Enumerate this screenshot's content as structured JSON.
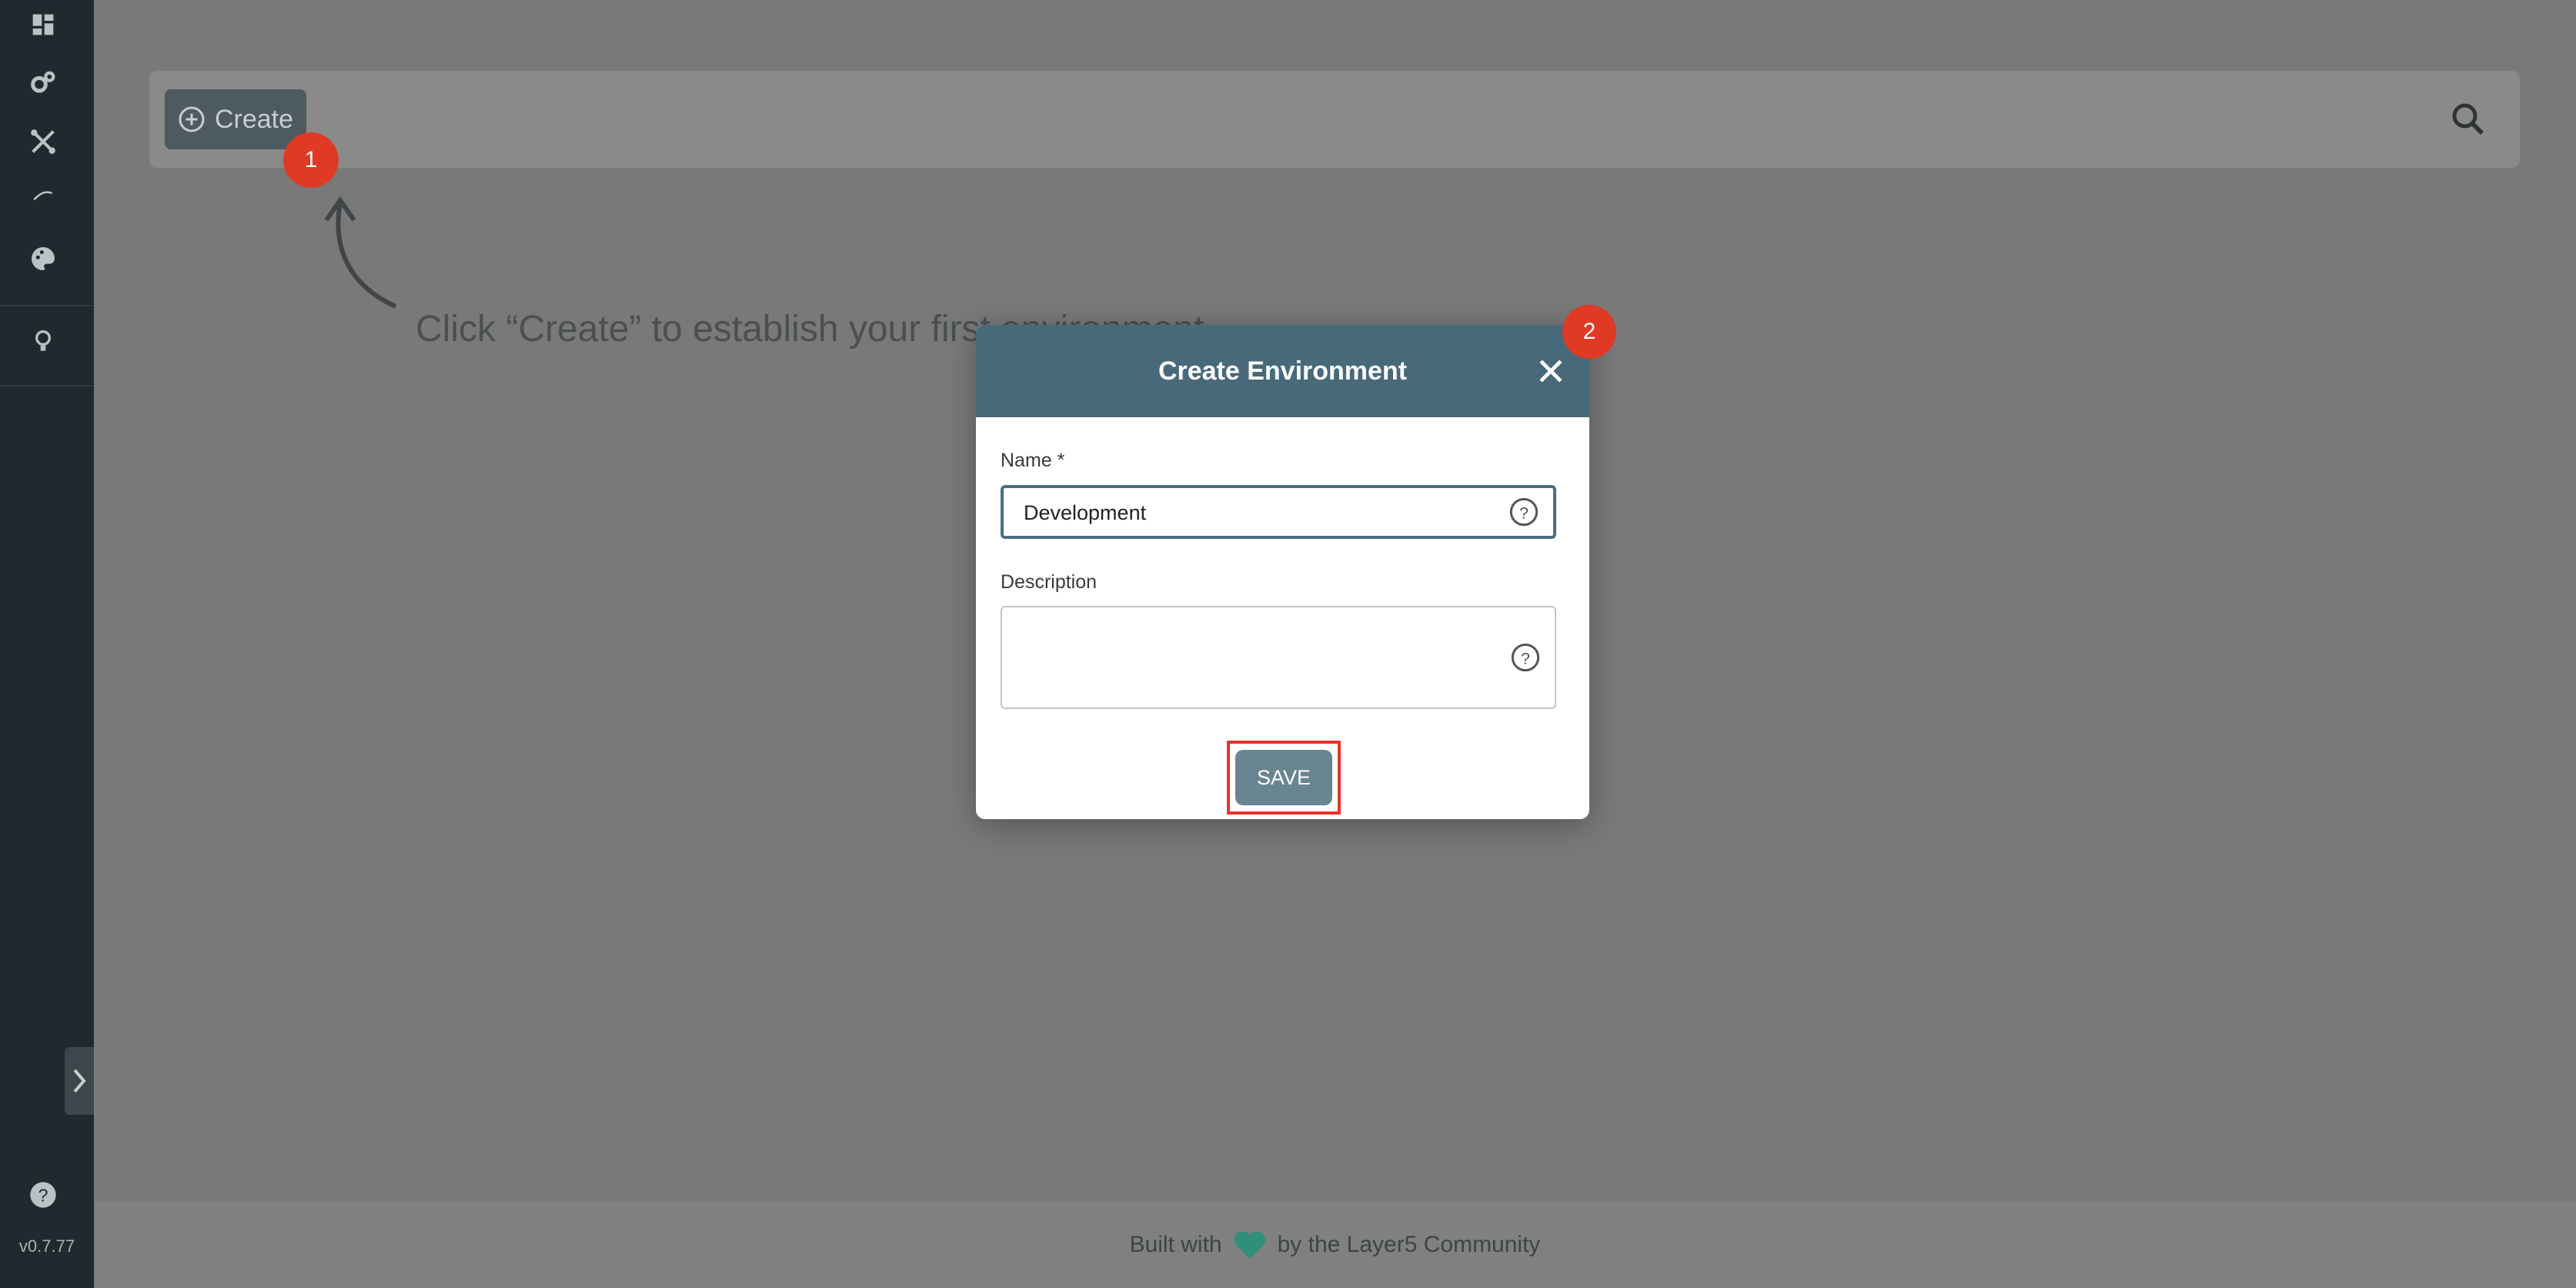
{
  "sidebar": {
    "items": [
      {
        "icon": "dashboard-icon"
      },
      {
        "icon": "gears-icon"
      },
      {
        "icon": "tools-icon"
      },
      {
        "icon": "curve-icon"
      },
      {
        "icon": "palette-icon"
      },
      {
        "icon": "lightbulb-icon"
      }
    ],
    "help_icon": "help-icon",
    "version": "v0.7.77"
  },
  "toolbar": {
    "create_label": "Create",
    "search_icon": "search-icon"
  },
  "badges": {
    "first": "1",
    "second": "2"
  },
  "hint": {
    "text": "Click “Create” to establish your first environment"
  },
  "modal": {
    "title": "Create Environment",
    "name_label": "Name *",
    "name_value": "Development",
    "description_label": "Description",
    "description_value": "",
    "save_label": "SAVE"
  },
  "footer": {
    "before": "Built with",
    "after": "by the Layer5 Community",
    "heart_color": "#2f8f7a"
  },
  "colors": {
    "sidebar": "#1f2a2e",
    "modal_header": "#48697a",
    "badge": "#e03a24",
    "highlight": "#e5352a"
  }
}
